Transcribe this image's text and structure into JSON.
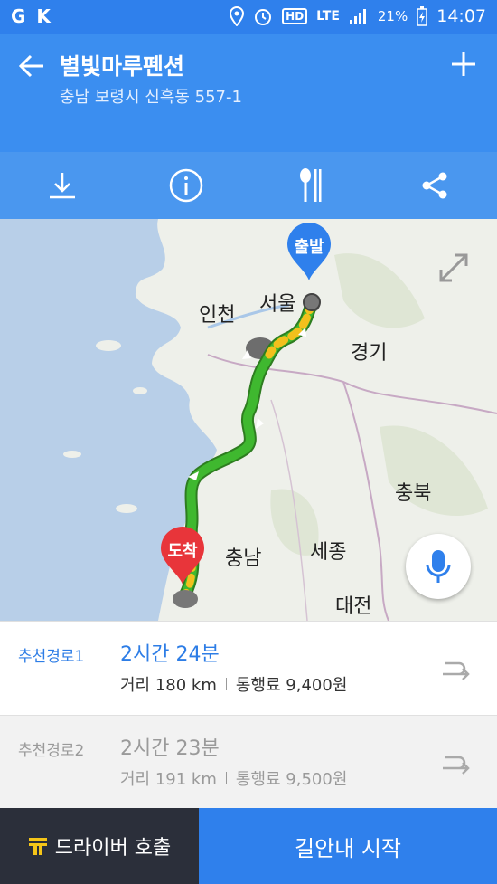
{
  "status_bar": {
    "battery": "21%",
    "network": "LTE",
    "time": "14:07"
  },
  "header": {
    "title": "별빛마루펜션",
    "address": "충남 보령시 신흑동 557-1"
  },
  "toolbar": {
    "items": [
      "download-icon",
      "info-icon",
      "restaurant-icon",
      "share-icon"
    ]
  },
  "map": {
    "labels": {
      "incheon": "인천",
      "seoul": "서울",
      "gyeonggi": "경기",
      "chungbuk": "충북",
      "chungnam": "충남",
      "sejong": "세종",
      "daejeon": "대전"
    },
    "start_pin": "출발",
    "end_pin": "도착",
    "colors": {
      "start_pin": "#2f80ec",
      "end_pin": "#e8353a",
      "route": "#3fb82f"
    }
  },
  "routes": [
    {
      "name": "추천경로1",
      "time": "2시간 24분",
      "distance": "거리 180 km",
      "toll": "통행료 9,400원",
      "selected": true
    },
    {
      "name": "추천경로2",
      "time": "2시간 23분",
      "distance": "거리 191 km",
      "toll": "통행료 9,500원",
      "selected": false
    }
  ],
  "bottom": {
    "driver_call": "드라이버 호출",
    "start_navigation": "길안내 시작"
  }
}
